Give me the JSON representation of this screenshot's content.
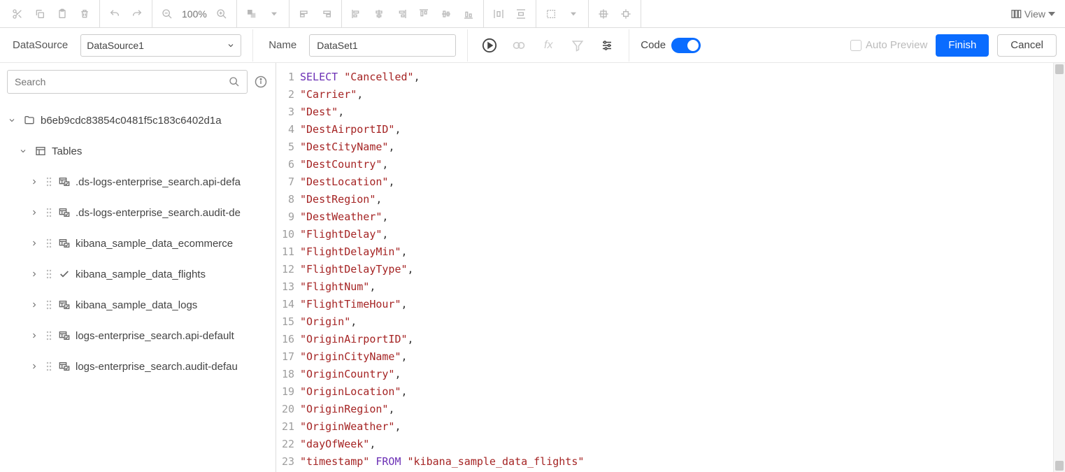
{
  "toolbar": {
    "zoom": "100%",
    "view_label": "View"
  },
  "config": {
    "datasource_label": "DataSource",
    "datasource_value": "DataSource1",
    "name_label": "Name",
    "name_value": "DataSet1",
    "code_label": "Code",
    "auto_preview_label": "Auto Preview",
    "finish_label": "Finish",
    "cancel_label": "Cancel"
  },
  "sidebar": {
    "search_placeholder": "Search",
    "db_name": "b6eb9cdc83854c0481f5c183c6402d1a",
    "tables_label": "Tables",
    "tables": [
      {
        "name": ".ds-logs-enterprise_search.api-defa",
        "selected": false
      },
      {
        "name": ".ds-logs-enterprise_search.audit-de",
        "selected": false
      },
      {
        "name": "kibana_sample_data_ecommerce",
        "selected": false
      },
      {
        "name": "kibana_sample_data_flights",
        "selected": true
      },
      {
        "name": "kibana_sample_data_logs",
        "selected": false
      },
      {
        "name": "logs-enterprise_search.api-default",
        "selected": false
      },
      {
        "name": "logs-enterprise_search.audit-defau",
        "selected": false
      }
    ]
  },
  "editor": {
    "lines": [
      [
        {
          "t": "kw",
          "v": "SELECT"
        },
        {
          "t": "sp",
          "v": " "
        },
        {
          "t": "str",
          "v": "\"Cancelled\""
        },
        {
          "t": "pun",
          "v": ","
        }
      ],
      [
        {
          "t": "str",
          "v": "\"Carrier\""
        },
        {
          "t": "pun",
          "v": ","
        }
      ],
      [
        {
          "t": "str",
          "v": "\"Dest\""
        },
        {
          "t": "pun",
          "v": ","
        }
      ],
      [
        {
          "t": "str",
          "v": "\"DestAirportID\""
        },
        {
          "t": "pun",
          "v": ","
        }
      ],
      [
        {
          "t": "str",
          "v": "\"DestCityName\""
        },
        {
          "t": "pun",
          "v": ","
        }
      ],
      [
        {
          "t": "str",
          "v": "\"DestCountry\""
        },
        {
          "t": "pun",
          "v": ","
        }
      ],
      [
        {
          "t": "str",
          "v": "\"DestLocation\""
        },
        {
          "t": "pun",
          "v": ","
        }
      ],
      [
        {
          "t": "str",
          "v": "\"DestRegion\""
        },
        {
          "t": "pun",
          "v": ","
        }
      ],
      [
        {
          "t": "str",
          "v": "\"DestWeather\""
        },
        {
          "t": "pun",
          "v": ","
        }
      ],
      [
        {
          "t": "str",
          "v": "\"FlightDelay\""
        },
        {
          "t": "pun",
          "v": ","
        }
      ],
      [
        {
          "t": "str",
          "v": "\"FlightDelayMin\""
        },
        {
          "t": "pun",
          "v": ","
        }
      ],
      [
        {
          "t": "str",
          "v": "\"FlightDelayType\""
        },
        {
          "t": "pun",
          "v": ","
        }
      ],
      [
        {
          "t": "str",
          "v": "\"FlightNum\""
        },
        {
          "t": "pun",
          "v": ","
        }
      ],
      [
        {
          "t": "str",
          "v": "\"FlightTimeHour\""
        },
        {
          "t": "pun",
          "v": ","
        }
      ],
      [
        {
          "t": "str",
          "v": "\"Origin\""
        },
        {
          "t": "pun",
          "v": ","
        }
      ],
      [
        {
          "t": "str",
          "v": "\"OriginAirportID\""
        },
        {
          "t": "pun",
          "v": ","
        }
      ],
      [
        {
          "t": "str",
          "v": "\"OriginCityName\""
        },
        {
          "t": "pun",
          "v": ","
        }
      ],
      [
        {
          "t": "str",
          "v": "\"OriginCountry\""
        },
        {
          "t": "pun",
          "v": ","
        }
      ],
      [
        {
          "t": "str",
          "v": "\"OriginLocation\""
        },
        {
          "t": "pun",
          "v": ","
        }
      ],
      [
        {
          "t": "str",
          "v": "\"OriginRegion\""
        },
        {
          "t": "pun",
          "v": ","
        }
      ],
      [
        {
          "t": "str",
          "v": "\"OriginWeather\""
        },
        {
          "t": "pun",
          "v": ","
        }
      ],
      [
        {
          "t": "str",
          "v": "\"dayOfWeek\""
        },
        {
          "t": "pun",
          "v": ","
        }
      ],
      [
        {
          "t": "str",
          "v": "\"timestamp\""
        },
        {
          "t": "sp",
          "v": " "
        },
        {
          "t": "kw",
          "v": "FROM"
        },
        {
          "t": "sp",
          "v": " "
        },
        {
          "t": "str",
          "v": "\"kibana_sample_data_flights\""
        }
      ]
    ]
  }
}
